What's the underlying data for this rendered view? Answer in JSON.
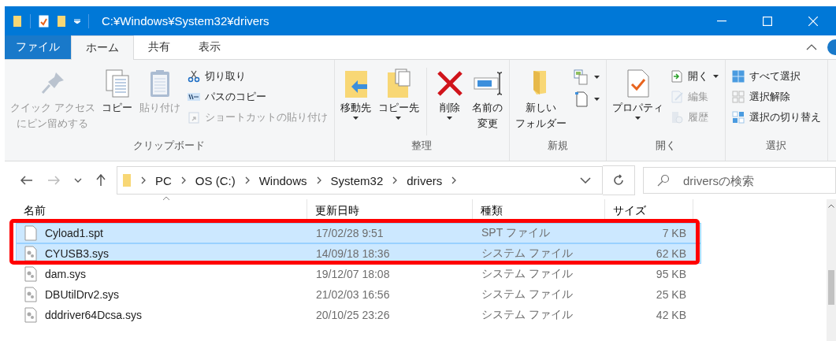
{
  "title_bar": {
    "path": "C:¥Windows¥System32¥drivers"
  },
  "tabs": [
    {
      "label": "ファイル",
      "kind": "file",
      "selected": false
    },
    {
      "label": "ホーム",
      "kind": "tab",
      "selected": true
    },
    {
      "label": "共有",
      "kind": "tab",
      "selected": false
    },
    {
      "label": "表示",
      "kind": "tab",
      "selected": false
    }
  ],
  "ribbon": {
    "groups": [
      {
        "label": "クリップボード",
        "columns": [
          {
            "kind": "large",
            "lines": [
              "クイック アクセス",
              "にピン留めする"
            ],
            "disabled": true,
            "dropdown": false
          },
          {
            "kind": "large",
            "lines": [
              "コピー"
            ],
            "disabled": false,
            "dropdown": false
          },
          {
            "kind": "large",
            "lines": [
              "貼り付け"
            ],
            "disabled": true,
            "dropdown": false
          },
          {
            "kind": "stack",
            "items": [
              {
                "label": "切り取り",
                "disabled": false,
                "dropdown": false
              },
              {
                "label": "パスのコピー",
                "disabled": false,
                "dropdown": false
              },
              {
                "label": "ショートカットの貼り付け",
                "disabled": true,
                "dropdown": false
              }
            ]
          }
        ]
      },
      {
        "label": "整理",
        "columns": [
          {
            "kind": "large",
            "lines": [
              "移動先"
            ],
            "disabled": false,
            "dropdown": true
          },
          {
            "kind": "large",
            "lines": [
              "コピー先"
            ],
            "disabled": false,
            "dropdown": true
          },
          {
            "kind": "divider"
          },
          {
            "kind": "large",
            "lines": [
              "削除"
            ],
            "disabled": false,
            "dropdown": true
          },
          {
            "kind": "large",
            "lines": [
              "名前の",
              "変更"
            ],
            "disabled": false,
            "dropdown": false
          }
        ]
      },
      {
        "label": "新規",
        "columns": [
          {
            "kind": "large",
            "lines": [
              "新しい",
              "フォルダー"
            ],
            "disabled": false,
            "dropdown": false
          },
          {
            "kind": "stack",
            "items": [
              {
                "disabled": false,
                "dropdown": true
              },
              {
                "disabled": false,
                "dropdown": true
              }
            ]
          }
        ]
      },
      {
        "label": "開く",
        "columns": [
          {
            "kind": "large",
            "lines": [
              "プロパティ"
            ],
            "disabled": false,
            "dropdown": true
          },
          {
            "kind": "stack",
            "items": [
              {
                "label": "開く",
                "disabled": false,
                "dropdown": true
              },
              {
                "label": "編集",
                "disabled": true,
                "dropdown": false
              },
              {
                "label": "履歴",
                "disabled": true,
                "dropdown": false
              }
            ]
          }
        ]
      },
      {
        "label": "選択",
        "columns": [
          {
            "kind": "stack",
            "items": [
              {
                "label": "すべて選択",
                "disabled": false,
                "dropdown": false
              },
              {
                "label": "選択解除",
                "disabled": false,
                "dropdown": false
              },
              {
                "label": "選択の切り替え",
                "disabled": false,
                "dropdown": false
              }
            ]
          }
        ]
      }
    ]
  },
  "address": {
    "breadcrumbs": [
      "PC",
      "OS (C:)",
      "Windows",
      "System32",
      "drivers"
    ],
    "search": {
      "placeholder": "driversの検索"
    }
  },
  "file_list": {
    "columns": [
      "名前",
      "更新日時",
      "種類",
      "サイズ"
    ],
    "rows": [
      {
        "name": "Cyload1.spt",
        "date": "17/02/28 9:51",
        "type": "SPT ファイル",
        "size": "7 KB",
        "kind": "document",
        "selected": true
      },
      {
        "name": "CYUSB3.sys",
        "date": "14/09/18 18:36",
        "type": "システム ファイル",
        "size": "62 KB",
        "kind": "system",
        "selected": true
      },
      {
        "name": "dam.sys",
        "date": "19/12/07 18:08",
        "type": "システム ファイル",
        "size": "95 KB",
        "kind": "system",
        "selected": false
      },
      {
        "name": "DBUtilDrv2.sys",
        "date": "21/02/03 16:56",
        "type": "システム ファイル",
        "size": "25 KB",
        "kind": "system",
        "selected": false
      },
      {
        "name": "dddriver64Dcsa.sys",
        "date": "20/10/25 23:26",
        "type": "システム ファイル",
        "size": "42 KB",
        "kind": "system",
        "selected": false
      }
    ]
  }
}
